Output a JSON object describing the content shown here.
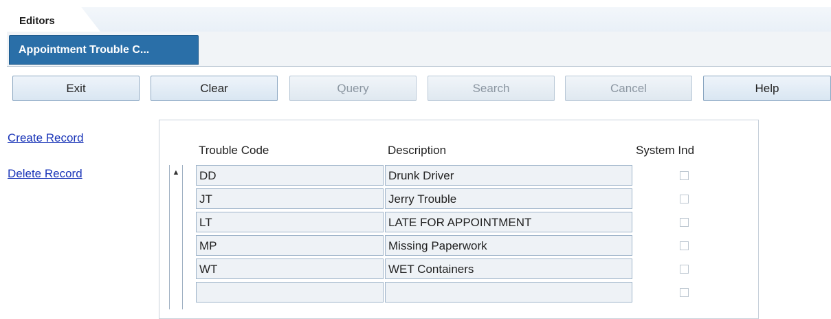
{
  "tabs": {
    "editors": "Editors",
    "app": "Appointment Trouble C..."
  },
  "toolbar": {
    "exit": "Exit",
    "clear": "Clear",
    "query": "Query",
    "search": "Search",
    "cancel": "Cancel",
    "help": "Help"
  },
  "links": {
    "create": "Create Record",
    "delete": "Delete Record"
  },
  "grid": {
    "headers": {
      "code": "Trouble Code",
      "description": "Description",
      "system_ind": "System Ind"
    },
    "rows": [
      {
        "code": "DD",
        "description": "Drunk Driver",
        "system_ind": false
      },
      {
        "code": "JT",
        "description": "Jerry Trouble",
        "system_ind": false
      },
      {
        "code": "LT",
        "description": "LATE FOR APPOINTMENT",
        "system_ind": false
      },
      {
        "code": "MP",
        "description": "Missing Paperwork",
        "system_ind": false
      },
      {
        "code": "WT",
        "description": "WET Containers",
        "system_ind": false
      },
      {
        "code": "",
        "description": "",
        "system_ind": false
      }
    ]
  },
  "icons": {
    "scroll_up": "scroll-up-arrow-icon"
  }
}
